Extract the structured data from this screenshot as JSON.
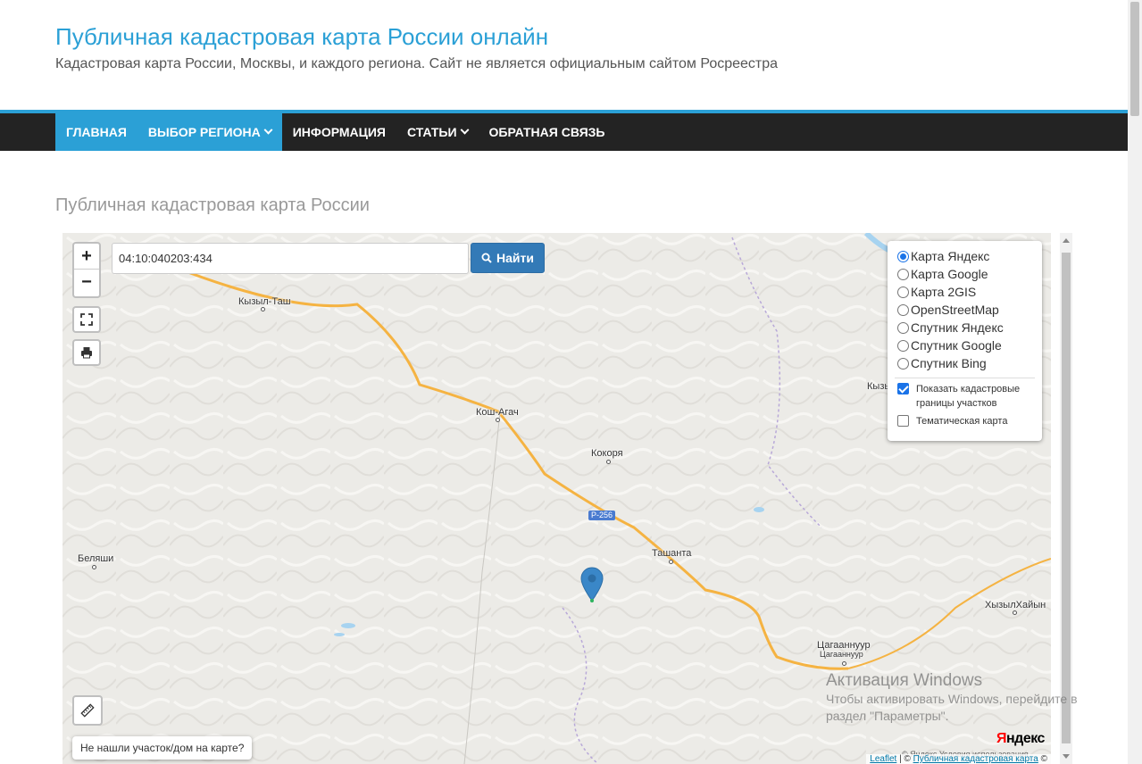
{
  "header": {
    "title": "Публичная кадастровая карта России онлайн",
    "tagline": "Кадастровая карта России, Москвы, и каждого региона. Сайт не является официальным сайтом Росреестра"
  },
  "nav": {
    "items": [
      {
        "label": "Главная",
        "active": true
      },
      {
        "label": "Выбор региона",
        "active": true,
        "dropdown": true
      },
      {
        "label": "Информация"
      },
      {
        "label": "Статьи",
        "dropdown": true
      },
      {
        "label": "Обратная связь"
      }
    ]
  },
  "page": {
    "heading": "Публичная кадастровая карта России"
  },
  "map": {
    "search": {
      "value": "04:10:040203:434",
      "button_label": "Найти"
    },
    "zoom": {
      "in": "+",
      "out": "−"
    },
    "layers": {
      "base": [
        {
          "label": "Карта Яндекс",
          "selected": true
        },
        {
          "label": "Карта Google"
        },
        {
          "label": "Карта 2GIS"
        },
        {
          "label": "OpenStreetMap"
        },
        {
          "label": "Спутник Яндекс"
        },
        {
          "label": "Спутник Google"
        },
        {
          "label": "Спутник Bing"
        }
      ],
      "overlays": [
        {
          "label": "Показать кадастровые границы участков",
          "checked": true
        },
        {
          "label": "Тематическая карта",
          "checked": false
        }
      ]
    },
    "places": {
      "kyzyl_tash": "Кызыл-Таш",
      "kosh_agach": "Кош-Агач",
      "kokorya": "Кокоря",
      "tashanta": "Ташанта",
      "belyashi": "Беляши",
      "khyzylkhaiyn": "ХызылХайын",
      "tsagaannuur_1": "Цагааннуур",
      "tsagaannuur_2": "Цагааннуур",
      "kyzy_cut": "Кызы"
    },
    "road_badge": "Р-256",
    "not_found": "Не нашли участок/дом на карте?",
    "logo": {
      "red": "Я",
      "rest": "ндекс"
    },
    "terms": "© Яндекс Условия использования",
    "attribution": {
      "leaflet": "Leaflet",
      "sep": " | © ",
      "site": "Публичная кадастровая карта",
      "tail": " ©"
    }
  },
  "watermark": {
    "title": "Активация Windows",
    "line1": "Чтобы активировать Windows, перейдите в",
    "line2": "раздел \"Параметры\"."
  },
  "colors": {
    "accent": "#2ba0d6",
    "nav_bg": "#232323",
    "button": "#337ab7",
    "road": "#f5b342",
    "marker": "#3a87c8"
  }
}
